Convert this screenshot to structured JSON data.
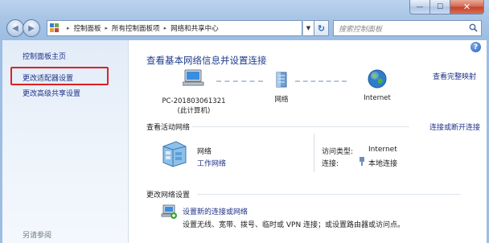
{
  "titlebar": {
    "min_label": "—",
    "max_label": "☐",
    "close_label": "✕"
  },
  "nav": {
    "back_glyph": "◀",
    "forward_glyph": "▶",
    "breadcrumbs": [
      "控制面板",
      "所有控制面板项",
      "网络和共享中心"
    ],
    "search_placeholder": "搜索控制面板",
    "refresh_glyph": "↻",
    "dropdown_glyph": "▼",
    "separator_glyph": "▸"
  },
  "sidebar": {
    "home_label": "控制面板主页",
    "items": [
      "更改适配器设置",
      "更改高级共享设置"
    ],
    "see_also_label": "另请参阅"
  },
  "main": {
    "help_glyph": "?",
    "title": "查看基本网络信息并设置连接",
    "full_map_link": "查看完整映射",
    "map_nodes": [
      {
        "label": "PC-201803061321",
        "sublabel": "(此计算机)",
        "icon": "computer-icon"
      },
      {
        "label": "网络",
        "icon": "network-icon"
      },
      {
        "label": "Internet",
        "icon": "globe-icon"
      }
    ],
    "active": {
      "heading": "查看活动网络",
      "connect_link": "连接或断开连接",
      "network_name": "网络",
      "network_type": "工作网络",
      "access_type_label": "访问类型:",
      "access_type_value": "Internet",
      "connection_label": "连接:",
      "connection_value": "本地连接"
    },
    "change": {
      "heading": "更改网络设置",
      "task_link": "设置新的连接或网络",
      "task_desc": "设置无线、宽带、拨号、临时或 VPN 连接；或设置路由器或访问点。"
    }
  },
  "colors": {
    "link": "#1e3287",
    "title": "#1f3d8c",
    "highlight_box": "#e02020"
  }
}
